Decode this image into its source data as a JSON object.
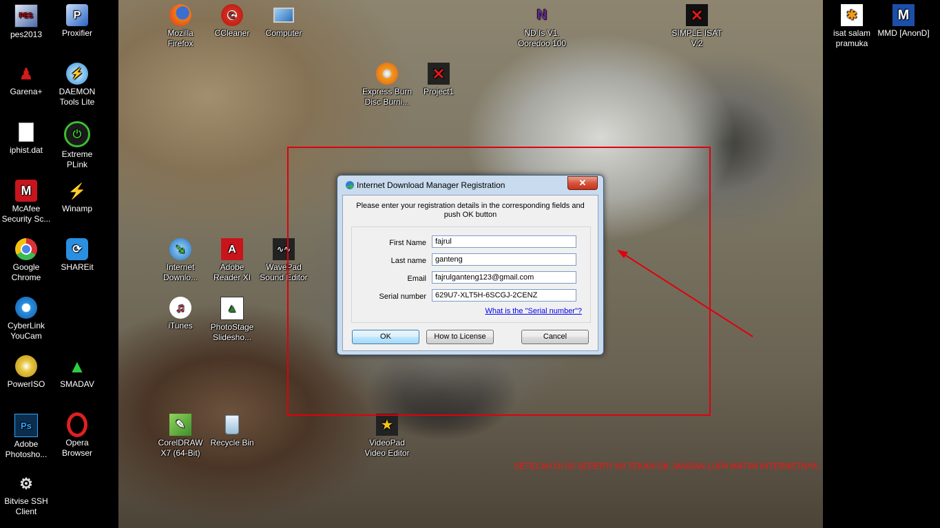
{
  "desktop": {
    "icons": [
      {
        "label": "pes2013",
        "icon": "pes2013-icon"
      },
      {
        "label": "Proxifier",
        "icon": "proxifier-icon"
      },
      {
        "label": "Mozilla Firefox",
        "icon": "firefox-icon"
      },
      {
        "label": "CCleaner",
        "icon": "ccleaner-icon"
      },
      {
        "label": "Computer",
        "icon": "computer-icon"
      },
      {
        "label": "ND Is V1. Ooredoo 100",
        "icon": "nd-icon"
      },
      {
        "label": "SIMPLE ISAT V.2",
        "icon": "simple-isat-icon"
      },
      {
        "label": "isat salam pramuka",
        "icon": "indosat-icon"
      },
      {
        "label": "MMD [AnonD]",
        "icon": "mmd-icon"
      },
      {
        "label": "Garena+",
        "icon": "garena-icon"
      },
      {
        "label": "DAEMON Tools Lite",
        "icon": "daemon-tools-icon"
      },
      {
        "label": "Express Burn Disc Burni...",
        "icon": "express-burn-icon"
      },
      {
        "label": "Project1",
        "icon": "project1-icon"
      },
      {
        "label": "iphist.dat",
        "icon": "file-icon"
      },
      {
        "label": "Extreme PLink",
        "icon": "extreme-plink-icon"
      },
      {
        "label": "McAfee Security Sc...",
        "icon": "mcafee-icon"
      },
      {
        "label": "Winamp",
        "icon": "winamp-icon"
      },
      {
        "label": "Google Chrome",
        "icon": "chrome-icon"
      },
      {
        "label": "SHAREit",
        "icon": "shareit-icon"
      },
      {
        "label": "Internet Downlo...",
        "icon": "idm-icon"
      },
      {
        "label": "Adobe Reader XI",
        "icon": "adobe-reader-icon"
      },
      {
        "label": "WavePad Sound Editor",
        "icon": "wavepad-icon"
      },
      {
        "label": "CyberLink YouCam",
        "icon": "youcam-icon"
      },
      {
        "label": "iTunes",
        "icon": "itunes-icon"
      },
      {
        "label": "PhotoStage Slidesho...",
        "icon": "photostage-icon"
      },
      {
        "label": "PowerISO",
        "icon": "poweriso-icon"
      },
      {
        "label": "SMADAV",
        "icon": "smadav-icon"
      },
      {
        "label": "Adobe Photosho...",
        "icon": "photoshop-icon"
      },
      {
        "label": "Opera Browser",
        "icon": "opera-icon"
      },
      {
        "label": "CorelDRAW X7 (64-Bit)",
        "icon": "coreldraw-icon"
      },
      {
        "label": "Recycle Bin",
        "icon": "recycle-bin-icon"
      },
      {
        "label": "VideoPad Video Editor",
        "icon": "videopad-icon"
      },
      {
        "label": "Bitvise SSH Client",
        "icon": "bitvise-icon"
      }
    ]
  },
  "dialog": {
    "title": "Internet Download Manager Registration",
    "close_label": "✕",
    "instructions": "Please enter your registration details in the corresponding fields and push OK button",
    "fields": {
      "first_name": {
        "label": "First Name",
        "value": "fajrul"
      },
      "last_name": {
        "label": "Last name",
        "value": "ganteng"
      },
      "email": {
        "label": "Email",
        "value": "fajrulganteng123@gmail.com"
      },
      "serial": {
        "label": "Serial number",
        "value": "629U7-XLT5H-6SCGJ-2CENZ"
      }
    },
    "help_link": "What is the \"Serial number\"?",
    "buttons": {
      "ok": "OK",
      "how_to_license": "How to License",
      "cancel": "Cancel"
    }
  },
  "annotation": {
    "text": "SETELAH DI ISI SEPERTI INI TEKAN OK JANGAN LUPA MATIIN INTERNETNYA",
    "color": "#ff1010"
  },
  "colors": {
    "highlight_box": "#e0000b",
    "link": "#0000ee"
  }
}
